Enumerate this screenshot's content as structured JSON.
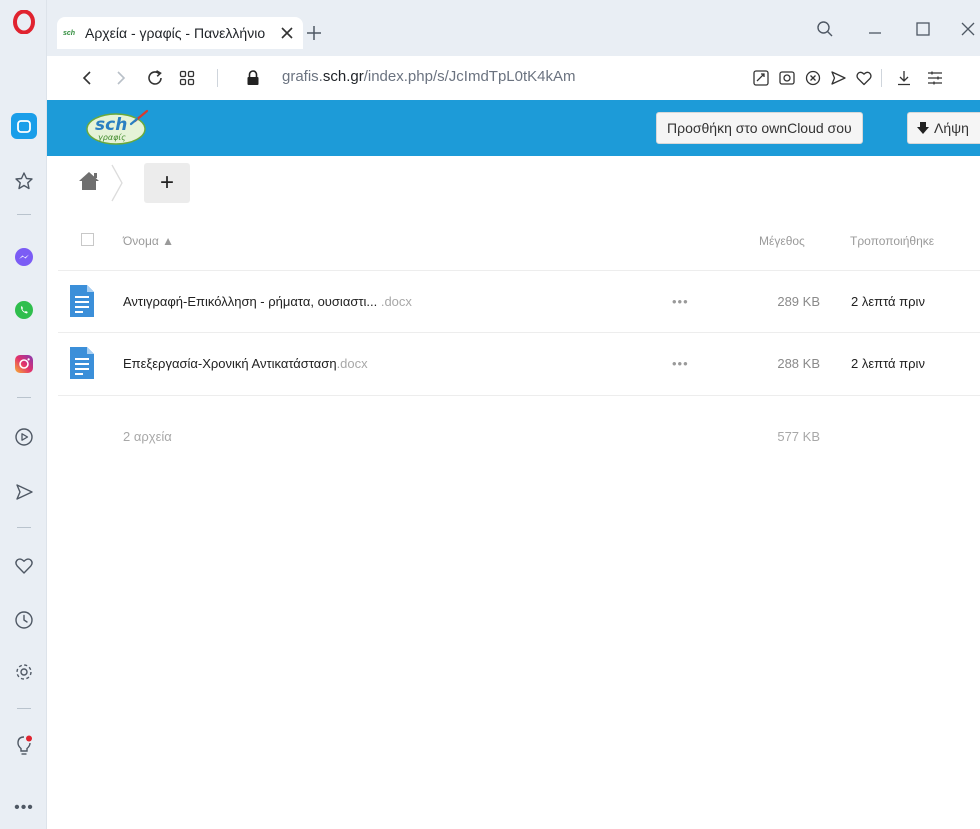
{
  "browser": {
    "tab": {
      "favicon_text": "sch",
      "title": "Αρχεία - γραφίς - Πανελλήνιο"
    },
    "url": {
      "prefix": "grafis.",
      "domain": "sch.gr",
      "path": "/index.php/s/JcImdTpL0tK4kAm"
    },
    "sidebar_items": [
      "home-icon",
      "bookmarks-icon",
      "messenger-icon",
      "whatsapp-icon",
      "instagram-icon",
      "player-icon",
      "flow-icon",
      "pinboard-icon",
      "history-icon",
      "settings-icon",
      "lucid-mode-icon",
      "more-icon"
    ],
    "accent_color": "#1a9ee9"
  },
  "owncloud": {
    "logo_text": "sch",
    "logo_subtext": "γραφίς",
    "add_button": "Προσθήκη στο ownCloud σου",
    "download_button": "Λήψη",
    "header_color": "#1d9bd8"
  },
  "breadcrumb": {
    "add_label": "+"
  },
  "files": {
    "headers": {
      "name": "Όνομα ▲",
      "size": "Μέγεθος",
      "modified": "Τροποποιήθηκε"
    },
    "rows": [
      {
        "name": "Αντιγραφή-Επικόλληση - ρήματα, ουσιαστι... ",
        "ext": ".docx",
        "menu": "•••",
        "size": "289 KB",
        "modified": "2 λεπτά πριν"
      },
      {
        "name": "Επεξεργασία-Χρονική Αντικατάσταση",
        "ext": ".docx",
        "menu": "•••",
        "size": "288 KB",
        "modified": "2 λεπτά πριν"
      }
    ],
    "summary": {
      "count": "2 αρχεία",
      "total_size": "577 KB"
    }
  }
}
